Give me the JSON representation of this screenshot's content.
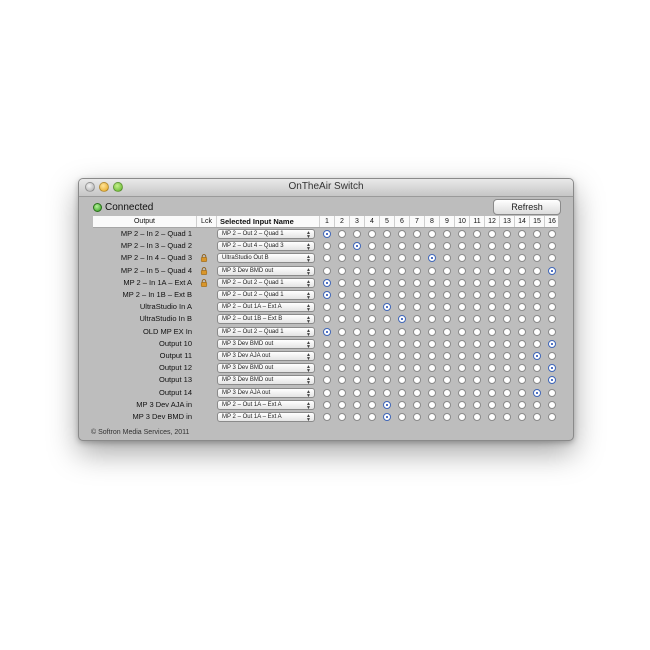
{
  "window": {
    "title": "OnTheAir Switch",
    "status": "Connected",
    "refresh_label": "Refresh",
    "copyright": "© Softron Media Services, 2011"
  },
  "columns": {
    "output": "Output",
    "lck": "Lck",
    "selected": "Selected Input Name",
    "numbers": [
      "1",
      "2",
      "3",
      "4",
      "5",
      "6",
      "7",
      "8",
      "9",
      "10",
      "11",
      "12",
      "13",
      "14",
      "15",
      "16"
    ]
  },
  "rows": [
    {
      "label": "MP 2 – In 2 – Quad 1",
      "lock": false,
      "selected": "MP 2 – Out 2 – Quad 1",
      "active": 1
    },
    {
      "label": "MP 2 – In 3 – Quad 2",
      "lock": false,
      "selected": "MP 2 – Out 4 – Quad 3",
      "active": 3
    },
    {
      "label": "MP 2 – In 4 – Quad 3",
      "lock": true,
      "selected": "UltraStudio Out B",
      "active": 8
    },
    {
      "label": "MP 2 – In 5 – Quad 4",
      "lock": true,
      "selected": "MP 3 Dev BMD out",
      "active": 16
    },
    {
      "label": "MP 2 – In 1A – Ext A",
      "lock": true,
      "selected": "MP 2 – Out 2 – Quad 1",
      "active": 1
    },
    {
      "label": "MP 2 – In 1B – Ext B",
      "lock": false,
      "selected": "MP 2 – Out 2 – Quad 1",
      "active": 1
    },
    {
      "label": "UltraStudio In A",
      "lock": false,
      "selected": "MP 2 – Out 1A – Ext A",
      "active": 5
    },
    {
      "label": "UltraStudio In B",
      "lock": false,
      "selected": "MP 2 – Out 1B – Ext B",
      "active": 6
    },
    {
      "label": "OLD MP EX In",
      "lock": false,
      "selected": "MP 2 – Out 2 – Quad 1",
      "active": 1
    },
    {
      "label": "Output 10",
      "lock": false,
      "selected": "MP 3 Dev BMD out",
      "active": 16
    },
    {
      "label": "Output 11",
      "lock": false,
      "selected": "MP 3 Dev AJA out",
      "active": 15
    },
    {
      "label": "Output 12",
      "lock": false,
      "selected": "MP 3 Dev BMD out",
      "active": 16
    },
    {
      "label": "Output 13",
      "lock": false,
      "selected": "MP 3 Dev BMD out",
      "active": 16
    },
    {
      "label": "Output 14",
      "lock": false,
      "selected": "MP 3 Dev AJA out",
      "active": 15
    },
    {
      "label": "MP 3 Dev AJA in",
      "lock": false,
      "selected": "MP 2 – Out 1A – Ext A",
      "active": 5
    },
    {
      "label": "MP 3 Dev BMD in",
      "lock": false,
      "selected": "MP 2 – Out 1A – Ext A",
      "active": 5
    }
  ],
  "colors": {
    "accent": "#1a47b8",
    "led": "#2c9a1a",
    "lock": "#d9962a"
  },
  "icons": {
    "lock": "lock-icon",
    "status": "status-led-icon",
    "stepper": "chevron-up-down-icon"
  }
}
